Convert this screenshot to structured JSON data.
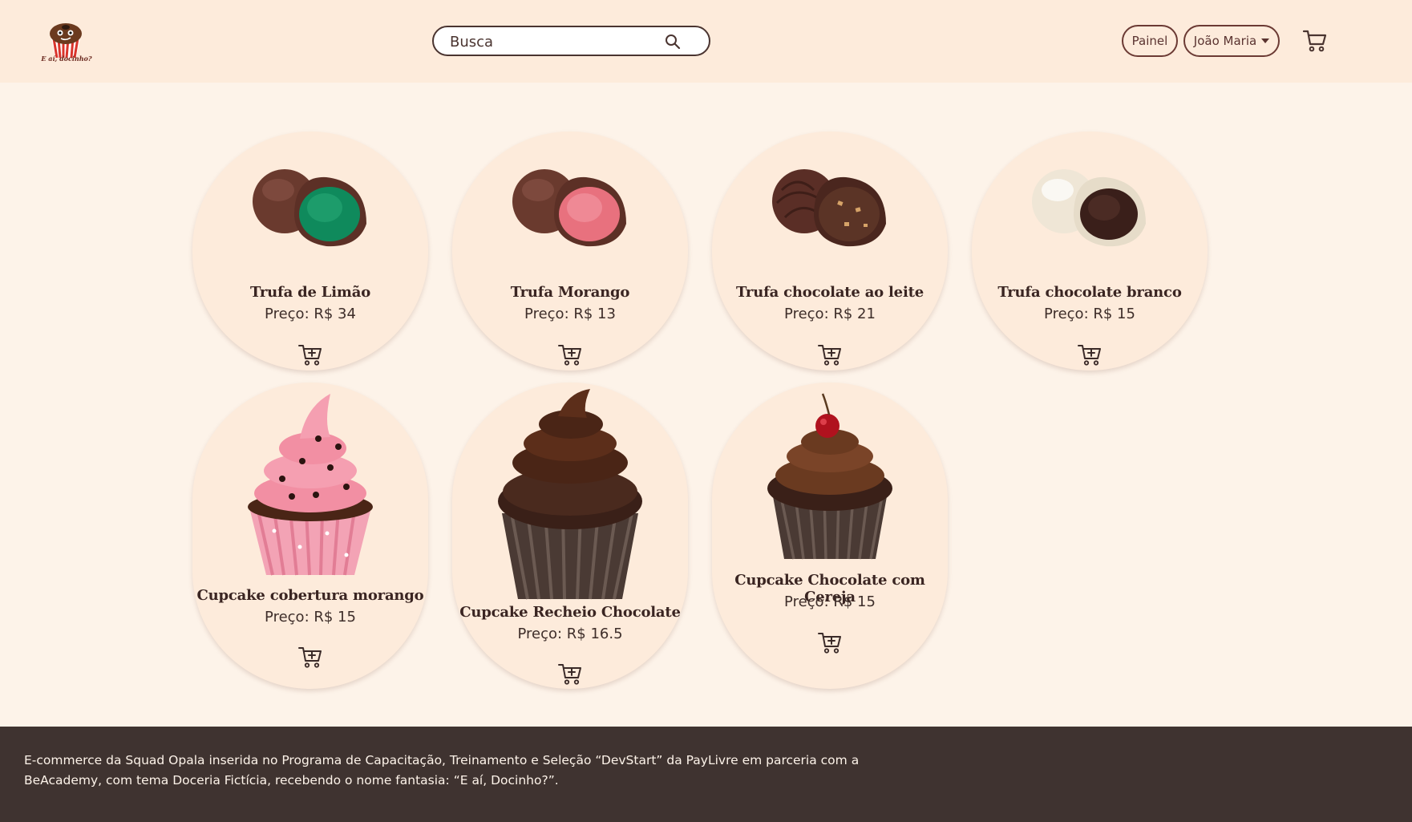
{
  "header": {
    "logo_text": "E aí, docinho?",
    "search": {
      "placeholder": "Busca",
      "value": ""
    },
    "painel_label": "Painel",
    "user_label": "João Maria",
    "icons": {
      "search": "search-icon",
      "cart": "cart-icon",
      "caret": "chevron-down-icon"
    }
  },
  "products": [
    {
      "name": "Trufa de Limão",
      "price": "Preço: R$ 34",
      "image": "truffle-lime",
      "filling_color": "#0f8a5c"
    },
    {
      "name": "Trufa Morango",
      "price": "Preço: R$ 13",
      "image": "truffle-strawberry",
      "filling_color": "#e8717e"
    },
    {
      "name": "Trufa chocolate ao leite",
      "price": "Preço: R$ 21",
      "image": "truffle-milk-chocolate",
      "filling_color": "#5b3426"
    },
    {
      "name": "Trufa chocolate branco",
      "price": "Preço: R$ 15",
      "image": "truffle-white-chocolate",
      "filling_color": "#3a1f1a"
    },
    {
      "name": "Cupcake cobertura morango",
      "price": "Preço: R$ 15",
      "image": "cupcake-strawberry",
      "frosting_color": "#f28fa3"
    },
    {
      "name": "Cupcake Recheio Chocolate",
      "price": "Preço: R$ 16.5",
      "image": "cupcake-chocolate",
      "frosting_color": "#4a2516"
    },
    {
      "name": "Cupcake Chocolate com Cereja",
      "price": "Preço: R$ 15",
      "image": "cupcake-cherry",
      "frosting_color": "#6a3a20"
    }
  ],
  "footer": {
    "text": "E-commerce da Squad Opala inserida no Programa de Capacitação, Treinamento e Seleção “DevStart” da PayLivre em parceria com a BeAcademy, com tema Doceria Fictícia, recebendo o nome fantasia: “E aí, Docinho?”."
  },
  "colors": {
    "header_bg": "#fdebdb",
    "page_bg": "#fdf3e9",
    "card_bg": "#fdebdb",
    "footer_bg": "#3f3330",
    "accent": "#6b3a34"
  }
}
